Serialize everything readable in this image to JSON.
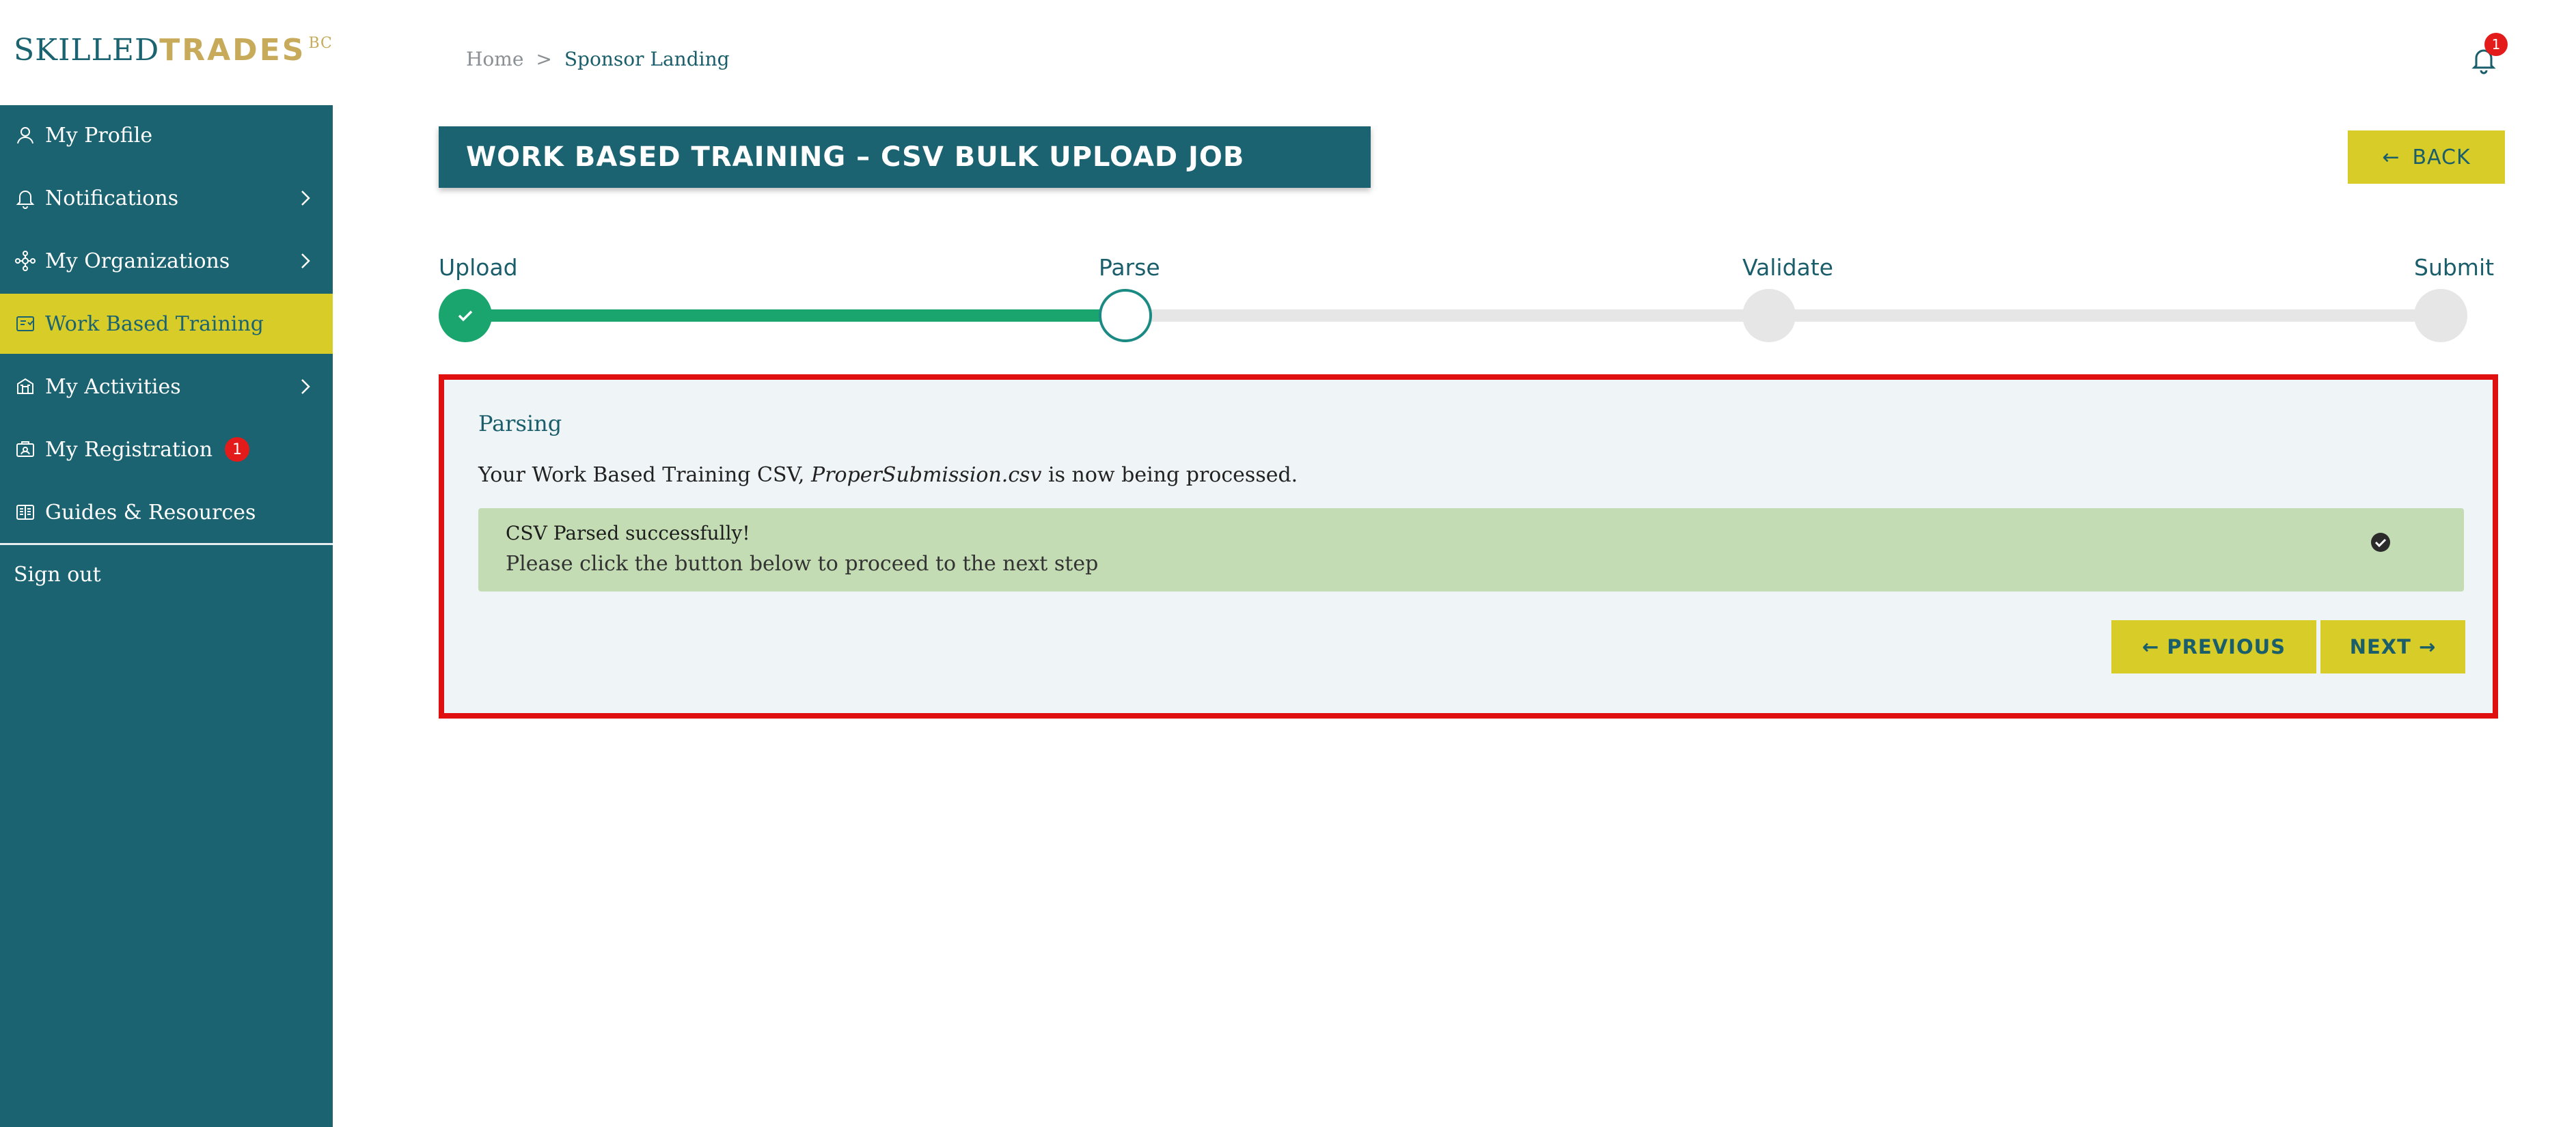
{
  "brand": {
    "part1": "SKILLED",
    "part2": "TRADES",
    "part3": "BC"
  },
  "sidebar": {
    "items": [
      {
        "label": "My Profile",
        "icon": "user-icon",
        "has_chevron": false
      },
      {
        "label": "Notifications",
        "icon": "bell-icon",
        "has_chevron": true
      },
      {
        "label": "My Organizations",
        "icon": "organization-icon",
        "has_chevron": true
      },
      {
        "label": "Work Based Training",
        "icon": "training-icon",
        "has_chevron": false,
        "active": true
      },
      {
        "label": "My Activities",
        "icon": "activities-icon",
        "has_chevron": true
      },
      {
        "label": "My Registration",
        "icon": "registration-icon",
        "has_chevron": false,
        "badge": "1"
      },
      {
        "label": "Guides & Resources",
        "icon": "guides-icon",
        "has_chevron": false
      }
    ],
    "signout": "Sign out"
  },
  "header": {
    "breadcrumb": {
      "home": "Home",
      "separator": ">",
      "current": "Sponsor Landing"
    },
    "notification_count": "1"
  },
  "page": {
    "title": "WORK BASED TRAINING – CSV BULK UPLOAD JOB",
    "back_label": "BACK"
  },
  "stepper": {
    "steps": [
      "Upload",
      "Parse",
      "Validate",
      "Submit"
    ],
    "completed_steps": 1,
    "current_step": 2
  },
  "panel": {
    "title": "Parsing",
    "message_prefix": "Your Work Based Training CSV, ",
    "file_name": "ProperSubmission.csv",
    "message_suffix": " is now being processed.",
    "success_title": "CSV Parsed successfully!",
    "success_sub": "Please click the button below to proceed to the next step",
    "previous_label": "← PREVIOUS",
    "next_label": "NEXT →"
  },
  "colors": {
    "brand_teal": "#1b6371",
    "accent_yellow": "#d7cc28",
    "success_green": "#1aa56e",
    "alert_red": "#e41b1b",
    "highlight_border": "#e01010",
    "success_bg": "#c3dcb3"
  }
}
